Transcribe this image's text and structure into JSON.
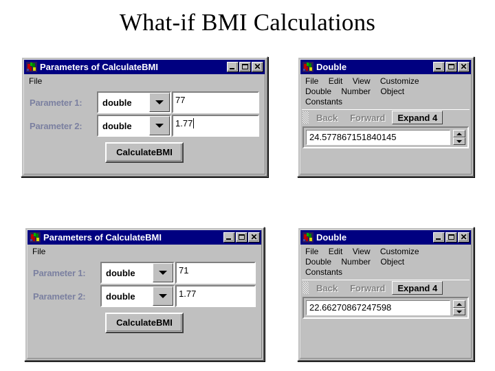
{
  "slide": {
    "title": "What-if BMI Calculations"
  },
  "windows": {
    "params_top": {
      "title": "Parameters of CalculateBMI",
      "icon": "app-icon",
      "controls": {
        "minimize": "_",
        "maximize": "□",
        "close": "✕"
      },
      "menu": [
        "File"
      ],
      "rows": [
        {
          "label": "Parameter 1:",
          "type": "double",
          "value": "77",
          "caret": false
        },
        {
          "label": "Parameter 2:",
          "type": "double",
          "value": "1.77",
          "caret": true
        }
      ],
      "button": "CalculateBMI"
    },
    "double_top": {
      "title": "Double",
      "icon": "app-icon",
      "controls": {
        "minimize": "_",
        "maximize": "□",
        "close": "✕"
      },
      "menu_rows": [
        [
          "File",
          "Edit",
          "View",
          "Customize"
        ],
        [
          "Double",
          "Number",
          "Object"
        ],
        [
          "Constants"
        ]
      ],
      "toolbar": {
        "gripper": "drag-gripper",
        "back": "Back",
        "forward": "Forward",
        "expand": "Expand 4"
      },
      "value": "24.577867151840145",
      "spinner": {
        "up": "spin-up",
        "down": "spin-down"
      }
    },
    "params_bottom": {
      "title": "Parameters of CalculateBMI",
      "icon": "app-icon",
      "controls": {
        "minimize": "_",
        "maximize": "□",
        "close": "✕"
      },
      "menu": [
        "File"
      ],
      "rows": [
        {
          "label": "Parameter 1:",
          "type": "double",
          "value": "71",
          "caret": false
        },
        {
          "label": "Parameter 2:",
          "type": "double",
          "value": "1.77",
          "caret": false
        }
      ],
      "button": "CalculateBMI"
    },
    "double_bottom": {
      "title": "Double",
      "icon": "app-icon",
      "controls": {
        "minimize": "_",
        "maximize": "□",
        "close": "✕"
      },
      "menu_rows": [
        [
          "File",
          "Edit",
          "View",
          "Customize"
        ],
        [
          "Double",
          "Number",
          "Object"
        ],
        [
          "Constants"
        ]
      ],
      "toolbar": {
        "gripper": "drag-gripper",
        "back": "Back",
        "forward": "Forward",
        "expand": "Expand 4"
      },
      "value": "22.66270867247598",
      "spinner": {
        "up": "spin-up",
        "down": "spin-down"
      }
    }
  },
  "colors": {
    "titlebar": "#000080",
    "face": "#c0c0c0",
    "label": "#7b80a0",
    "disabled_text": "#808080"
  }
}
